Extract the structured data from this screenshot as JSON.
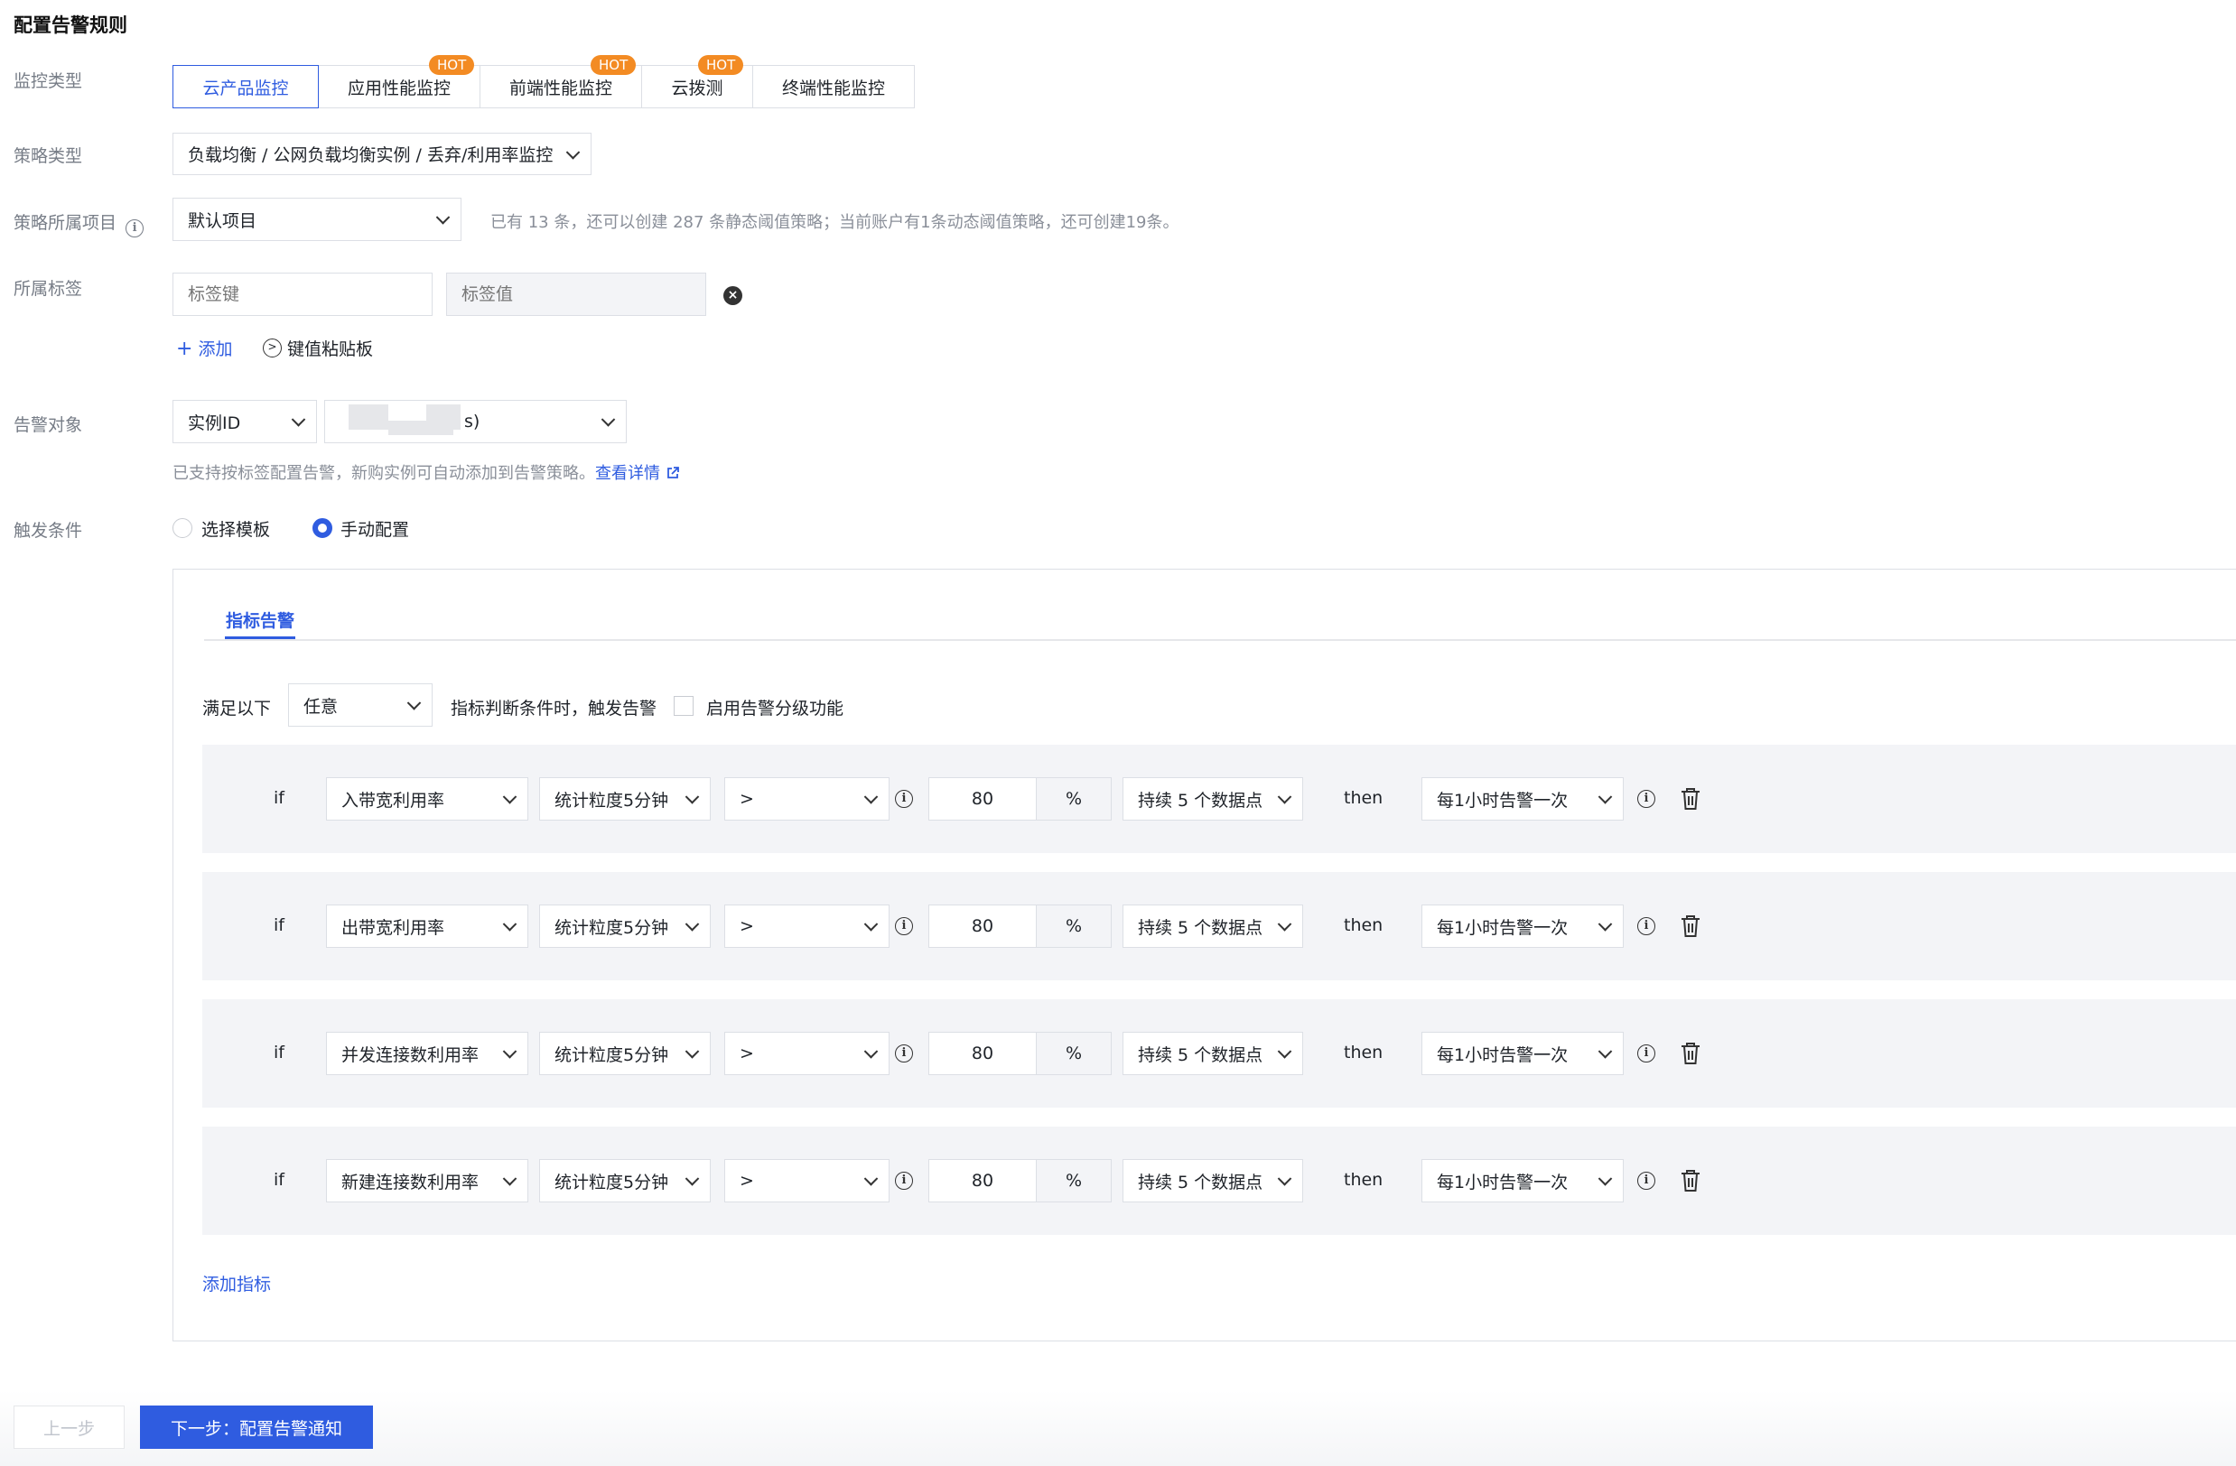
{
  "page_title": "配置告警规则",
  "labels": {
    "monitor_type": "监控类型",
    "policy_type": "策略类型",
    "project": "策略所属项目",
    "tags": "所属标签",
    "alarm_object": "告警对象",
    "trigger": "触发条件"
  },
  "monitor_tabs": [
    {
      "label": "云产品监控",
      "hot": "",
      "active": true
    },
    {
      "label": "应用性能监控",
      "hot": "HOT",
      "active": false
    },
    {
      "label": "前端性能监控",
      "hot": "HOT",
      "active": false
    },
    {
      "label": "云拨测",
      "hot": "HOT",
      "active": false
    },
    {
      "label": "终端性能监控",
      "hot": "",
      "active": false
    }
  ],
  "policy_type_value": "负载均衡 / 公网负载均衡实例 / 丢弃/利用率监控",
  "project": {
    "value": "默认项目",
    "hint": "已有 13 条，还可以创建 287 条静态阈值策略；当前账户有1条动态阈值策略，还可创建19条。"
  },
  "tags": {
    "key_placeholder": "标签键",
    "value_placeholder": "标签值",
    "add_label": "添加",
    "paste_label": "键值粘贴板"
  },
  "alarm_object": {
    "type_value": "实例ID",
    "instance_value": "s)",
    "hint": "已支持按标签配置告警，新购实例可自动添加到告警策略。",
    "detail_link": "查看详情"
  },
  "trigger": {
    "option_template": "选择模板",
    "option_manual": "手动配置",
    "selected": "手动配置"
  },
  "panel": {
    "tab_label": "指标告警",
    "satisfy_prefix": "满足以下",
    "satisfy_value": "任意",
    "satisfy_suffix": "指标判断条件时，触发告警",
    "grading_label": "启用告警分级功能",
    "add_metric": "添加指标"
  },
  "rules": [
    {
      "if": "if",
      "metric": "入带宽利用率",
      "granularity": "统计粒度5分钟",
      "operator": ">",
      "threshold": "80",
      "unit": "%",
      "duration": "持续 5 个数据点",
      "then": "then",
      "frequency": "每1小时告警一次"
    },
    {
      "if": "if",
      "metric": "出带宽利用率",
      "granularity": "统计粒度5分钟",
      "operator": ">",
      "threshold": "80",
      "unit": "%",
      "duration": "持续 5 个数据点",
      "then": "then",
      "frequency": "每1小时告警一次"
    },
    {
      "if": "if",
      "metric": "并发连接数利用率",
      "granularity": "统计粒度5分钟",
      "operator": ">",
      "threshold": "80",
      "unit": "%",
      "duration": "持续 5 个数据点",
      "then": "then",
      "frequency": "每1小时告警一次"
    },
    {
      "if": "if",
      "metric": "新建连接数利用率",
      "granularity": "统计粒度5分钟",
      "operator": ">",
      "threshold": "80",
      "unit": "%",
      "duration": "持续 5 个数据点",
      "then": "then",
      "frequency": "每1小时告警一次"
    }
  ],
  "footer": {
    "prev_label": "上一步",
    "next_label": "下一步：配置告警通知"
  },
  "colors": {
    "primary": "#2f5ce0",
    "hot_badge": "#f38b23",
    "row_bg": "#f3f4f7",
    "border": "#dcdfe5"
  }
}
